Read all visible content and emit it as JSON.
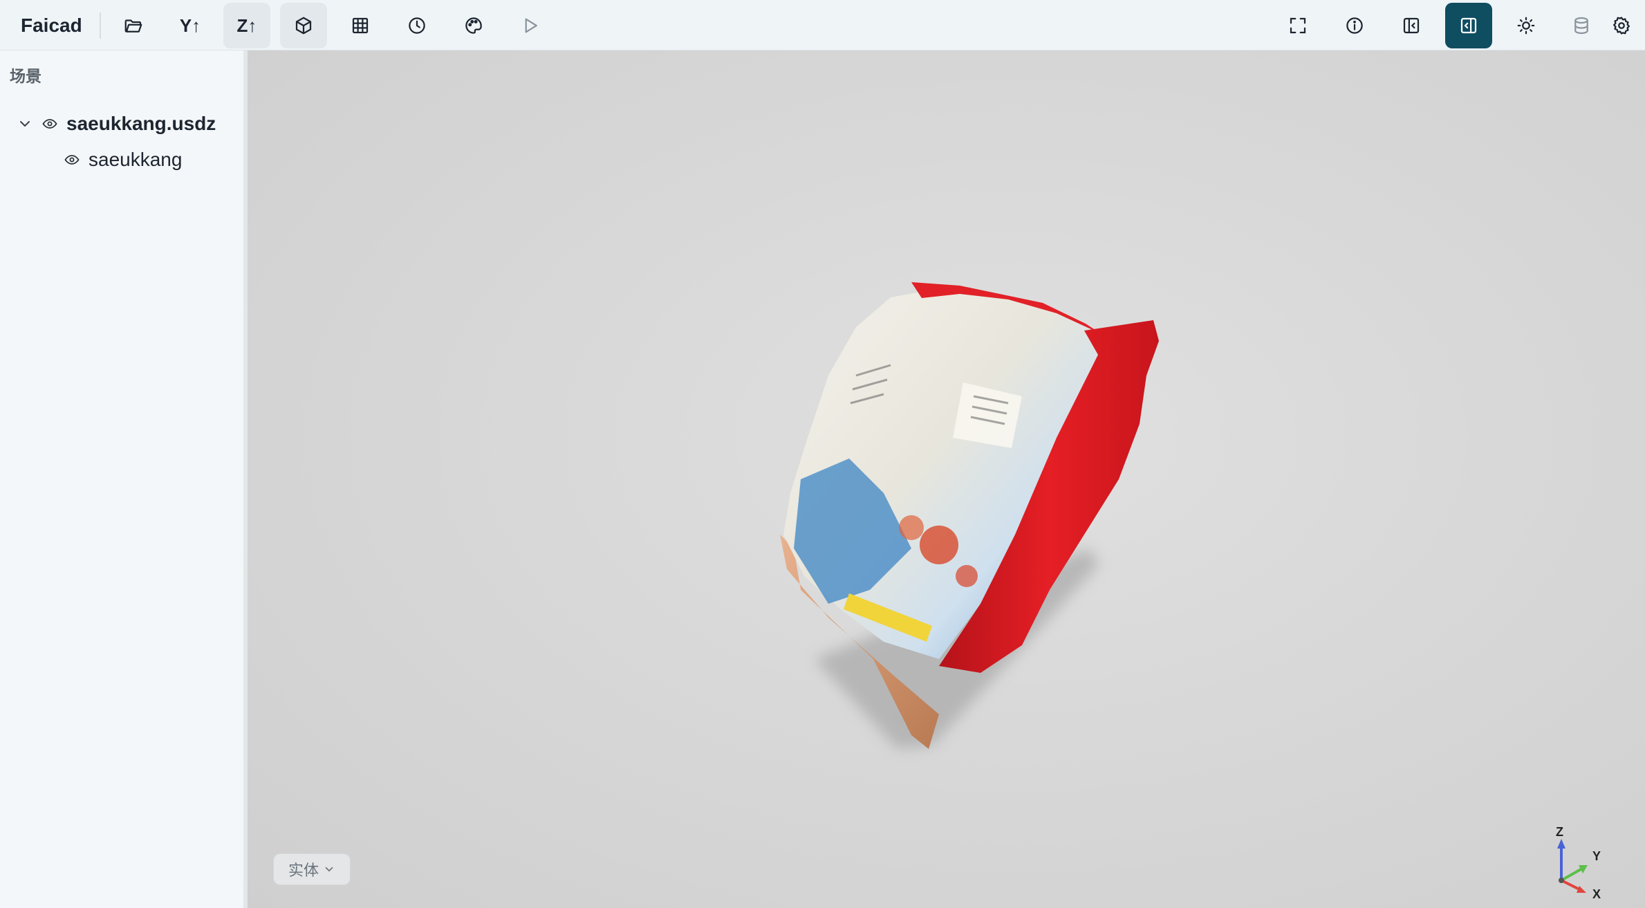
{
  "app": {
    "title": "Faicad"
  },
  "toolbar": {
    "y_up_label": "Y↑",
    "z_up_label": "Z↑",
    "left_icons": [
      "folder-open-icon",
      "y-up-button",
      "z-up-button",
      "cube-icon",
      "grid-table-icon",
      "clock-icon",
      "palette-icon",
      "play-icon"
    ],
    "right_icons": [
      "fullscreen-icon",
      "info-icon",
      "panel-left-icon",
      "panel-right-icon",
      "sun-icon",
      "database-icon",
      "gear-icon"
    ],
    "active_button": "panel-right-icon"
  },
  "sidebar": {
    "header": "场景",
    "tree": [
      {
        "label": "saeukkang.usdz",
        "expanded": true,
        "visible": true
      },
      {
        "label": "saeukkang",
        "visible": true
      }
    ]
  },
  "viewport": {
    "mode_select": {
      "value": "实体"
    },
    "axes": {
      "z": "Z",
      "y": "Y",
      "x": "X"
    }
  },
  "colors": {
    "accent": "#0f4d61",
    "toolbar_bg": "#eff4f7",
    "viewport_bg": "#d8d8d8"
  }
}
